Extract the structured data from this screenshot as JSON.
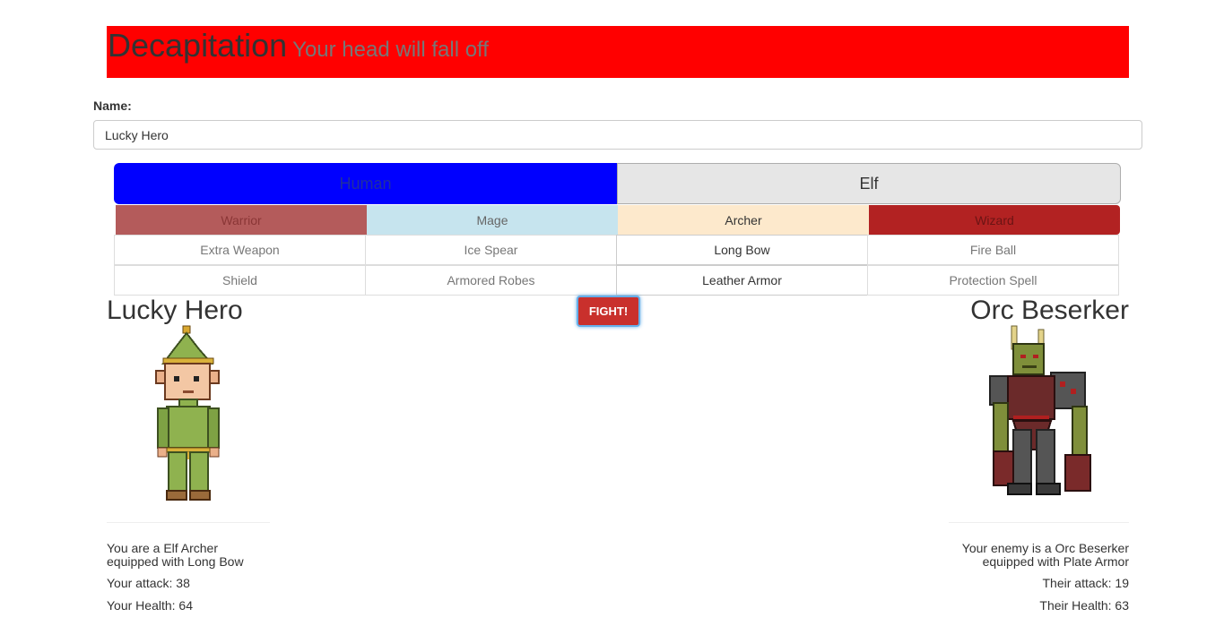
{
  "header": {
    "title": "Decapitation",
    "subtitle": "Your head will fall off"
  },
  "form": {
    "name_label": "Name:",
    "name_value": "Lucky Hero"
  },
  "races": [
    {
      "label": "Human"
    },
    {
      "label": "Elf"
    }
  ],
  "classes": [
    {
      "label": "Warrior"
    },
    {
      "label": "Mage"
    },
    {
      "label": "Archer"
    },
    {
      "label": "Wizard"
    }
  ],
  "weapons": [
    {
      "label": "Extra Weapon"
    },
    {
      "label": "Ice Spear"
    },
    {
      "label": "Long Bow"
    },
    {
      "label": "Fire Ball"
    }
  ],
  "armors": [
    {
      "label": "Shield"
    },
    {
      "label": "Armored Robes"
    },
    {
      "label": "Leather Armor"
    },
    {
      "label": "Protection Spell"
    }
  ],
  "fight_label": "FIGHT!",
  "hero": {
    "name": "Lucky Hero",
    "line1": "You are a Elf Archer",
    "line2": "equipped with Long Bow",
    "attack": "Your attack: 38",
    "health": "Your Health: 64"
  },
  "enemy": {
    "name": "Orc Beserker",
    "line1": "Your enemy is a Orc Beserker",
    "line2": "equipped with Plate Armor",
    "attack": "Their attack: 19",
    "health": "Their Health: 63"
  },
  "colors": {
    "banner": "#ff0000",
    "human_selected": "#0000ff",
    "warrior": "#b45b5b",
    "mage": "#c6e4ee",
    "archer": "#fde9cc",
    "wizard": "#b22222",
    "fight": "#c9302c"
  },
  "icons": {
    "hero_sprite": "elf-archer-sprite",
    "enemy_sprite": "orc-beserker-sprite"
  }
}
